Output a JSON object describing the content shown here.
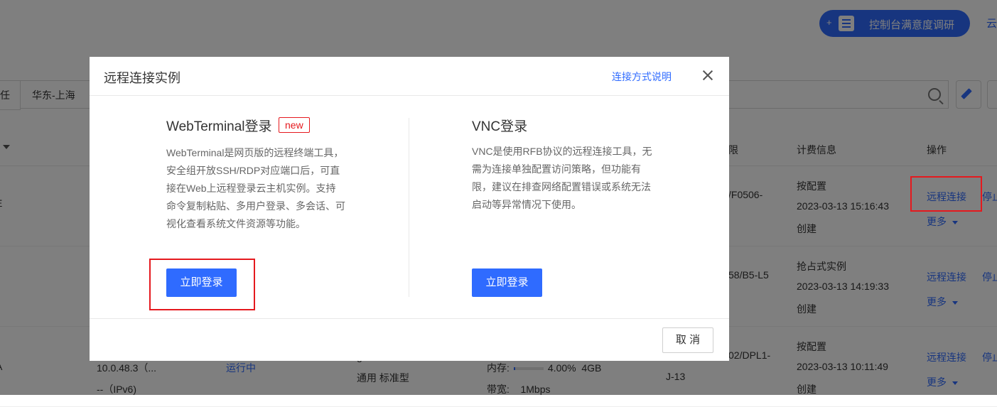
{
  "topbar": {
    "survey_plus": "+",
    "survey_label": "控制台满意度调研",
    "right_fragment": "云"
  },
  "filters": {
    "left_fragment": "任",
    "region": "华东-上海"
  },
  "table": {
    "headers": {
      "fragment": "限",
      "billing": "计费信息",
      "operations": "操作"
    },
    "rows": [
      {
        "left_fragment": "E",
        "spec_fragment": "/F0506-",
        "billing_type": "按配置",
        "created_time": "2023-03-13 15:16:43",
        "created_label": "创建",
        "connect": "远程连接",
        "stop": "停止",
        "more": "更多"
      },
      {
        "spec_fragment": "58/B5-L5",
        "billing_type": "抢占式实例",
        "created_time": "2023-03-13 14:19:33",
        "created_label": "创建",
        "connect": "远程连接",
        "stop": "停止",
        "more": "更多"
      },
      {
        "left_fragment": "A",
        "ip": "10.0.48.3（...",
        "ipv6": "--（IPv6)",
        "status": "运行中",
        "g_fragment": "g",
        "type": "通用 标准型",
        "memory_label": "内存:",
        "memory_percent": "4.00%",
        "memory_fraction": 0.04,
        "memory_total": "4GB",
        "bandwidth_label": "带宽:",
        "bandwidth": "1Mbps",
        "spec_fragment": "02/DPL1-",
        "spec_fragment2": "J-13",
        "billing_type": "按配置",
        "created_time": "2023-03-13 10:11:49",
        "created_label": "创建",
        "connect": "远程连接",
        "stop": "停止",
        "more": "更多"
      }
    ]
  },
  "modal": {
    "title": "远程连接实例",
    "help_link": "连接方式说明",
    "webterminal": {
      "title": "WebTerminal登录",
      "badge": "new",
      "description": "WebTerminal是网页版的远程终端工具，安全组开放SSH/RDP对应端口后，可直接在Web上远程登录云主机实例。支持命令复制粘贴、多用户登录、多会话、可视化查看系统文件资源等功能。",
      "button": "立即登录"
    },
    "vnc": {
      "title": "VNC登录",
      "description": "VNC是使用RFB协议的远程连接工具，无需为连接单独配置访问策略，但功能有限，建议在排查网络配置错误或系统无法启动等异常情况下使用。",
      "button": "立即登录"
    },
    "cancel": "取 消"
  },
  "colors": {
    "primary": "#2f6bff",
    "highlight_red": "#e5191e",
    "overlay": "rgba(0,0,0,0.5)"
  }
}
